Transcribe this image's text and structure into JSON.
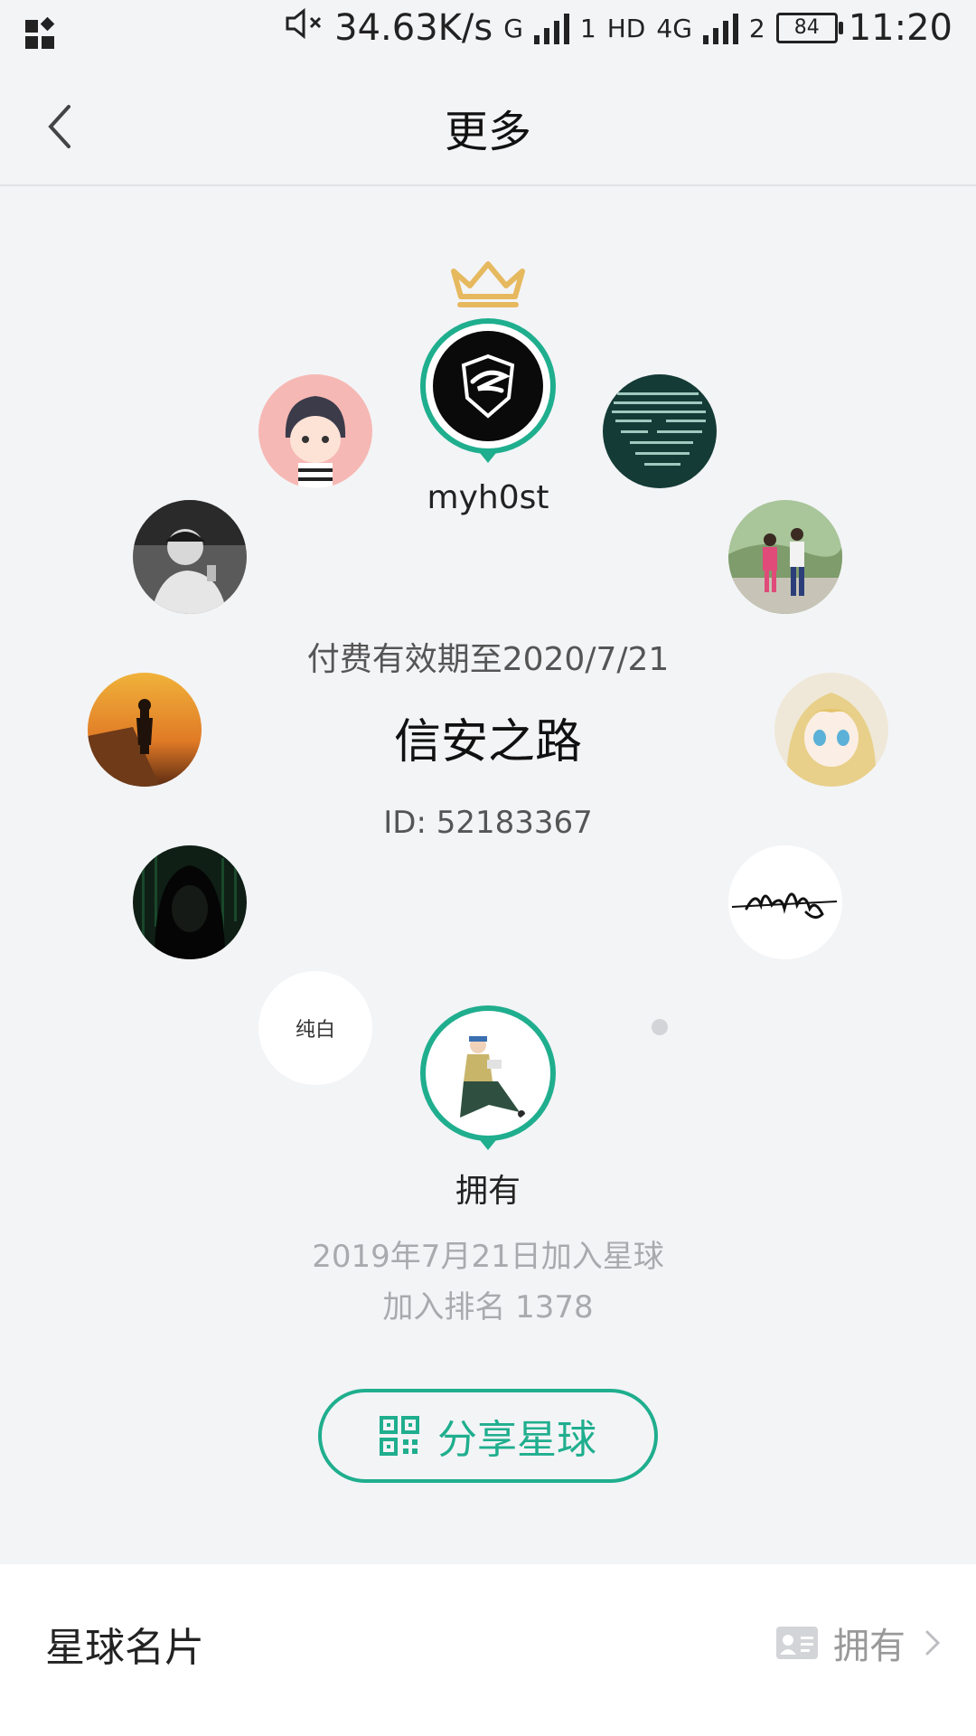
{
  "status_bar": {
    "net_speed": "34.63K/s",
    "sim1_type": "G",
    "sim1_index": "1",
    "hd_label": "HD",
    "sim2_type": "4G",
    "sim2_index": "2",
    "battery": "84",
    "time": "11:20",
    "icons": [
      "app-grid-icon",
      "mute-icon",
      "signal-icon",
      "battery-icon"
    ]
  },
  "nav": {
    "title": "更多",
    "back_icon": "chevron-left-icon"
  },
  "owner": {
    "name": "myh0st",
    "badge_icon": "crown-icon"
  },
  "planet": {
    "expiry": "付费有效期至2020/7/21",
    "name": "信安之路",
    "id": "ID: 52183367"
  },
  "members": {
    "text_avatar_label": "纯白"
  },
  "me": {
    "name": "拥有",
    "join_date": "2019年7月21日加入星球",
    "join_rank": "加入排名 1378"
  },
  "share_button": {
    "label": "分享星球",
    "icon": "qr-code-icon"
  },
  "card_row": {
    "label": "星球名片",
    "value": "拥有",
    "icons": [
      "id-card-icon",
      "chevron-right-icon"
    ]
  },
  "colors": {
    "accent": "#1fae8e",
    "crown": "#e6b95f",
    "background": "#f3f4f6"
  }
}
